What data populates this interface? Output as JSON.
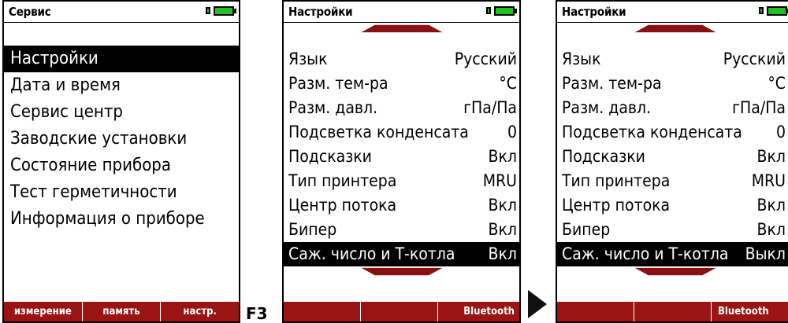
{
  "screen1": {
    "title": "Сервис",
    "menu": [
      {
        "label": "Настройки",
        "selected": true
      },
      {
        "label": "Дата и время",
        "selected": false
      },
      {
        "label": "Сервис центр",
        "selected": false
      },
      {
        "label": "Заводские установки",
        "selected": false
      },
      {
        "label": "Состояние прибора",
        "selected": false
      },
      {
        "label": "Тест герметичности",
        "selected": false
      },
      {
        "label": "Информация о приборе",
        "selected": false
      }
    ],
    "softkeys": [
      "измерение",
      "память",
      "настр."
    ]
  },
  "f3_label": "F3",
  "screen2": {
    "title": "Настройки",
    "rows": [
      {
        "label": "Язык",
        "value": "Русский"
      },
      {
        "label": "Разм. тем-ра",
        "value": "°C"
      },
      {
        "label": "Разм. давл.",
        "value": "гПа/Па"
      },
      {
        "label": "Подсветка конденсата",
        "value": "0"
      },
      {
        "label": "Подсказки",
        "value": "Вкл"
      },
      {
        "label": "Тип принтера",
        "value": "MRU"
      },
      {
        "label": "Центр потока",
        "value": "Вкл"
      },
      {
        "label": "Бипер",
        "value": "Вкл"
      },
      {
        "label": "Саж. число и Т-котла",
        "value": "Вкл",
        "selected": true
      }
    ],
    "softkeys": [
      "",
      "",
      "Bluetooth"
    ]
  },
  "screen3": {
    "title": "Настройки",
    "rows": [
      {
        "label": "Язык",
        "value": "Русский"
      },
      {
        "label": "Разм. тем-ра",
        "value": "°C"
      },
      {
        "label": "Разм. давл.",
        "value": "гПа/Па"
      },
      {
        "label": "Подсветка конденсата",
        "value": "0"
      },
      {
        "label": "Подсказки",
        "value": "Вкл"
      },
      {
        "label": "Тип принтера",
        "value": "MRU"
      },
      {
        "label": "Центр потока",
        "value": "Вкл"
      },
      {
        "label": "Бипер",
        "value": "Вкл"
      },
      {
        "label": "Саж. число и Т-котла",
        "value": "Выкл",
        "selected": true
      }
    ],
    "softkeys": [
      "",
      "",
      "Bluetooth"
    ]
  },
  "colors": {
    "softbar": "#9b1414",
    "scroll_arrow": "#8b1010",
    "battery": "#1fc21f"
  },
  "icons": [
    "battery-icon",
    "scroll-up-icon",
    "scroll-down-icon",
    "transition-arrow-icon"
  ]
}
